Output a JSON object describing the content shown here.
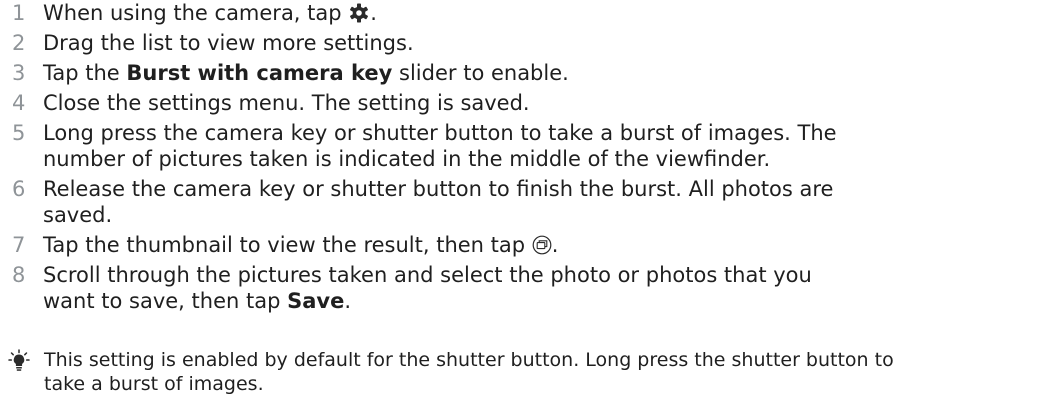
{
  "steps": [
    {
      "num": "1",
      "a": "When using the camera, tap ",
      "icon": "gear-icon",
      "b": "."
    },
    {
      "num": "2",
      "a": "Drag the list to view more settings."
    },
    {
      "num": "3",
      "a": "Tap the ",
      "bold": "Burst with camera key",
      "b": " slider to enable."
    },
    {
      "num": "4",
      "a": "Close the settings menu. The setting is saved."
    },
    {
      "num": "5",
      "line1": "Long press the camera key or shutter button to take a burst of images. The",
      "line2": "number of pictures taken is indicated in the middle of the viewfinder."
    },
    {
      "num": "6",
      "line1": "Release the camera key or shutter button to finish the burst. All photos are",
      "line2": "saved."
    },
    {
      "num": "7",
      "a": "Tap the thumbnail to view the result, then tap ",
      "icon": "burst-gallery-icon",
      "b": "."
    },
    {
      "num": "8",
      "line1": "Scroll through the pictures taken and select the photo or photos that you",
      "line2a": "want to save, then tap ",
      "bold": "Save",
      "b": "."
    }
  ],
  "tip": {
    "icon": "lightbulb-tip-icon",
    "line1": "This setting is enabled by default for the shutter button. Long press the shutter button to",
    "line2": "take a burst of images."
  },
  "colors": {
    "text": "#1f1f1f",
    "step_number": "#8f9498",
    "icon": "#2b2b2b"
  }
}
